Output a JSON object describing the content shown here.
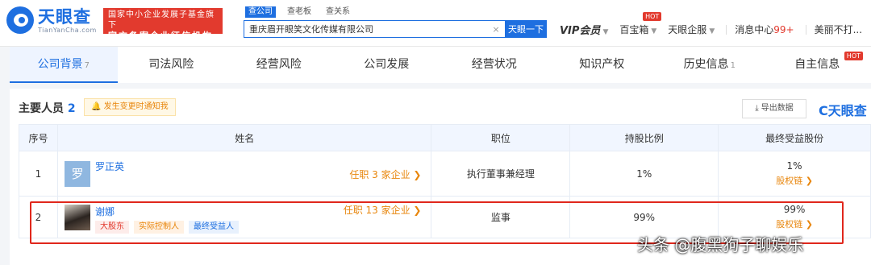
{
  "logo": {
    "cn": "天眼查",
    "en": "TianYanCha.com"
  },
  "red_badge": {
    "line1": "国家中小企业发展子基金旗下",
    "line2": "官方备案企业征信机构"
  },
  "search": {
    "tabs": [
      "查公司",
      "查老板",
      "查关系"
    ],
    "value": "重庆眉开眼笑文化传媒有限公司",
    "clear": "×",
    "button": "天眼一下"
  },
  "topnav": {
    "vip": "VIP会员",
    "baibaoxiang": "百宝箱",
    "hot": "HOT",
    "qiyefu": "天眼企服",
    "messages": "消息中心",
    "messages_count": "99+",
    "user": "美丽不打..."
  },
  "tabs": [
    {
      "label": "公司背景",
      "count": "7"
    },
    {
      "label": "司法风险",
      "count": ""
    },
    {
      "label": "经营风险",
      "count": ""
    },
    {
      "label": "公司发展",
      "count": ""
    },
    {
      "label": "经营状况",
      "count": ""
    },
    {
      "label": "知识产权",
      "count": ""
    },
    {
      "label": "历史信息",
      "count": "1"
    },
    {
      "label": "自主信息",
      "count": ""
    }
  ],
  "tab_hot": "HOT",
  "section": {
    "title": "主要人员",
    "count": "2",
    "notify": "发生变更时通知我",
    "export": "导出数据",
    "brand": "天眼查"
  },
  "table": {
    "headers": [
      "序号",
      "姓名",
      "职位",
      "持股比例",
      "最终受益股份"
    ],
    "rows": [
      {
        "index": "1",
        "avatar_char": "罗",
        "name": "罗正英",
        "tenure": "任职 3 家企业 ❯",
        "position": "执行董事兼经理",
        "share": "1%",
        "benefit": "1%",
        "benefit_link": "股权链 ❯",
        "tags": []
      },
      {
        "index": "2",
        "avatar_char": "",
        "name": "谢娜",
        "tenure": "任职 13 家企业 ❯",
        "position": "监事",
        "share": "99%",
        "benefit": "99%",
        "benefit_link": "股权链 ❯",
        "tags": [
          "大股东",
          "实际控制人",
          "最终受益人"
        ]
      }
    ]
  },
  "watermark": "头条 @腹黑狗子聊娱乐"
}
